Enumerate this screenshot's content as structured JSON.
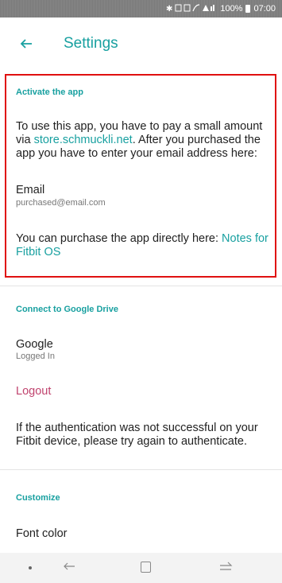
{
  "status_bar": {
    "icons": "✱ ⊘ ⊘ ☎ ⸮ .▐",
    "battery": "100%",
    "time": "07:00"
  },
  "app_bar": {
    "title": "Settings"
  },
  "activate": {
    "header": "Activate the app",
    "text_before_link": "To use this app, you have to pay a small amount via ",
    "store_link": "store.schmuckli.net",
    "text_after_link": ". After you purchased the app you have to enter your email address here:",
    "email_label": "Email",
    "email_placeholder": "purchased@email.com",
    "purchase_text": "You can purchase the app directly here: ",
    "purchase_link": "Notes for Fitbit OS"
  },
  "google_drive": {
    "header": "Connect to Google Drive",
    "account_label": "Google",
    "account_status": "Logged In",
    "logout_label": "Logout",
    "auth_note": "If the authentication was not successful on your Fitbit device, please try again to authenticate."
  },
  "customize": {
    "header": "Customize",
    "font_color_label": "Font color"
  },
  "colors": {
    "accent": "#18a0a0",
    "logout": "#c0436e",
    "highlight_border": "#e01010"
  }
}
